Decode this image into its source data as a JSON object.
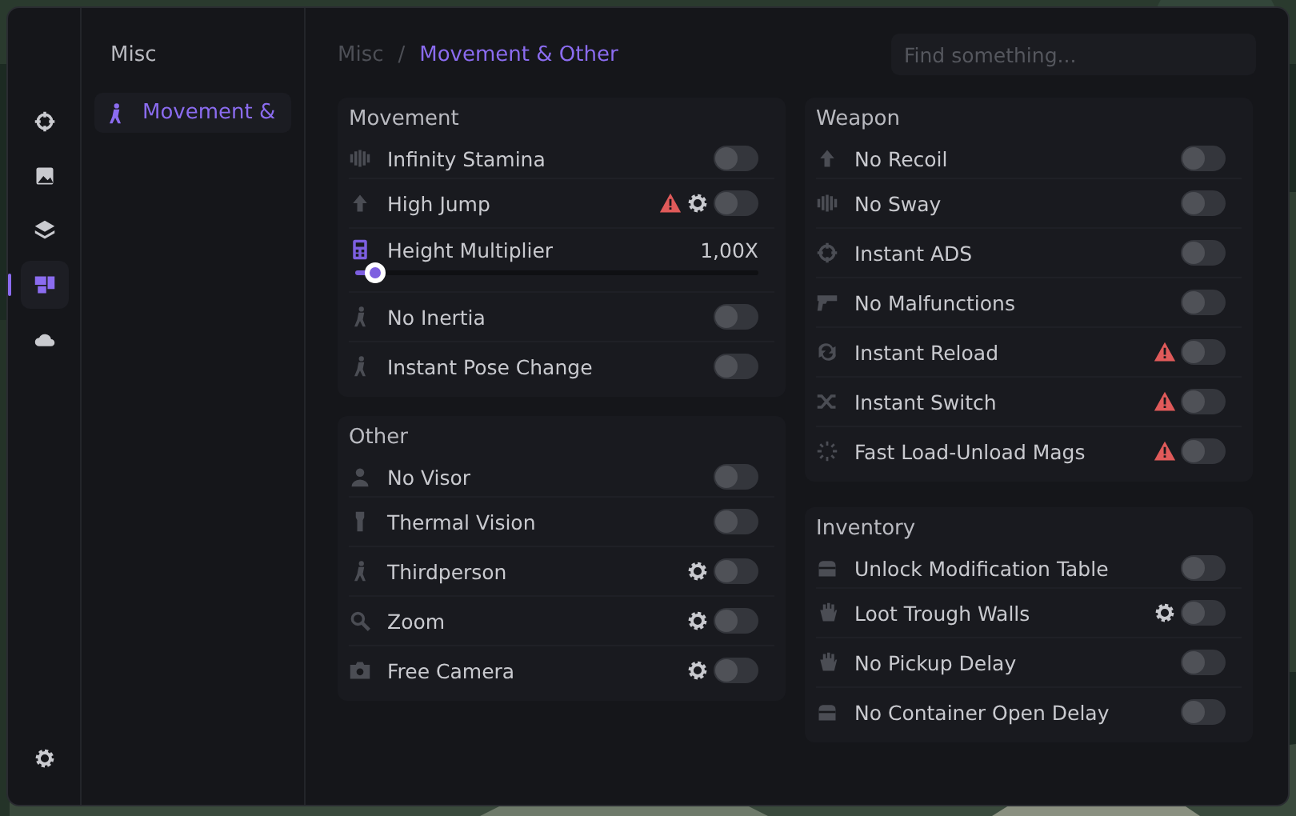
{
  "rail": [
    {
      "selected": false
    },
    {
      "selected": false
    },
    {
      "selected": false
    },
    {
      "selected": true
    },
    {
      "selected": false
    }
  ],
  "submenu": {
    "title": "Misc",
    "items": [
      {
        "label": "Movement &",
        "selected": true
      }
    ]
  },
  "breadcrumb": {
    "parent": "Misc",
    "separator": "/",
    "current": "Movement & Other"
  },
  "search": {
    "placeholder": "Find something..."
  },
  "columns": [
    [
      {
        "title": "Movement",
        "rows": [
          {
            "kind": "toggle",
            "label": "Infinity Stamina",
            "on": false,
            "warning": false,
            "settings": false
          },
          {
            "kind": "toggle",
            "label": "High Jump",
            "on": false,
            "warning": true,
            "settings": true
          },
          {
            "kind": "slider",
            "label": "Height Multiplier",
            "reading": "1,00X",
            "level": 0.03
          },
          {
            "kind": "toggle",
            "label": "No Inertia",
            "on": false,
            "warning": false,
            "settings": false
          },
          {
            "kind": "toggle",
            "label": "Instant Pose Change",
            "on": false,
            "warning": false,
            "settings": false
          }
        ]
      },
      {
        "title": "Other",
        "rows": [
          {
            "kind": "toggle",
            "label": "No Visor",
            "on": false,
            "warning": false,
            "settings": false
          },
          {
            "kind": "toggle",
            "label": "Thermal Vision",
            "on": false,
            "warning": false,
            "settings": false
          },
          {
            "kind": "toggle",
            "label": "Thirdperson",
            "on": false,
            "warning": false,
            "settings": true
          },
          {
            "kind": "toggle",
            "label": "Zoom",
            "on": false,
            "warning": false,
            "settings": true
          },
          {
            "kind": "toggle",
            "label": "Free Camera",
            "on": false,
            "warning": false,
            "settings": true
          }
        ]
      }
    ],
    [
      {
        "title": "Weapon",
        "rows": [
          {
            "kind": "toggle",
            "label": "No Recoil",
            "on": false,
            "warning": false,
            "settings": false
          },
          {
            "kind": "toggle",
            "label": "No Sway",
            "on": false,
            "warning": false,
            "settings": false
          },
          {
            "kind": "toggle",
            "label": "Instant ADS",
            "on": false,
            "warning": false,
            "settings": false
          },
          {
            "kind": "toggle",
            "label": "No Malfunctions",
            "on": false,
            "warning": false,
            "settings": false
          },
          {
            "kind": "toggle",
            "label": "Instant Reload",
            "on": false,
            "warning": true,
            "settings": false
          },
          {
            "kind": "toggle",
            "label": "Instant Switch",
            "on": false,
            "warning": true,
            "settings": false
          },
          {
            "kind": "toggle",
            "label": "Fast Load-Unload Mags",
            "on": false,
            "warning": true,
            "settings": false
          }
        ]
      },
      {
        "title": "Inventory",
        "rows": [
          {
            "kind": "toggle",
            "label": "Unlock Modification Table",
            "on": false,
            "warning": false,
            "settings": false
          },
          {
            "kind": "toggle",
            "label": "Loot Trough Walls",
            "on": false,
            "warning": false,
            "settings": true
          },
          {
            "kind": "toggle",
            "label": "No Pickup Delay",
            "on": false,
            "warning": false,
            "settings": false
          },
          {
            "kind": "toggle",
            "label": "No Container Open Delay",
            "on": false,
            "warning": false,
            "settings": false
          }
        ]
      }
    ]
  ]
}
